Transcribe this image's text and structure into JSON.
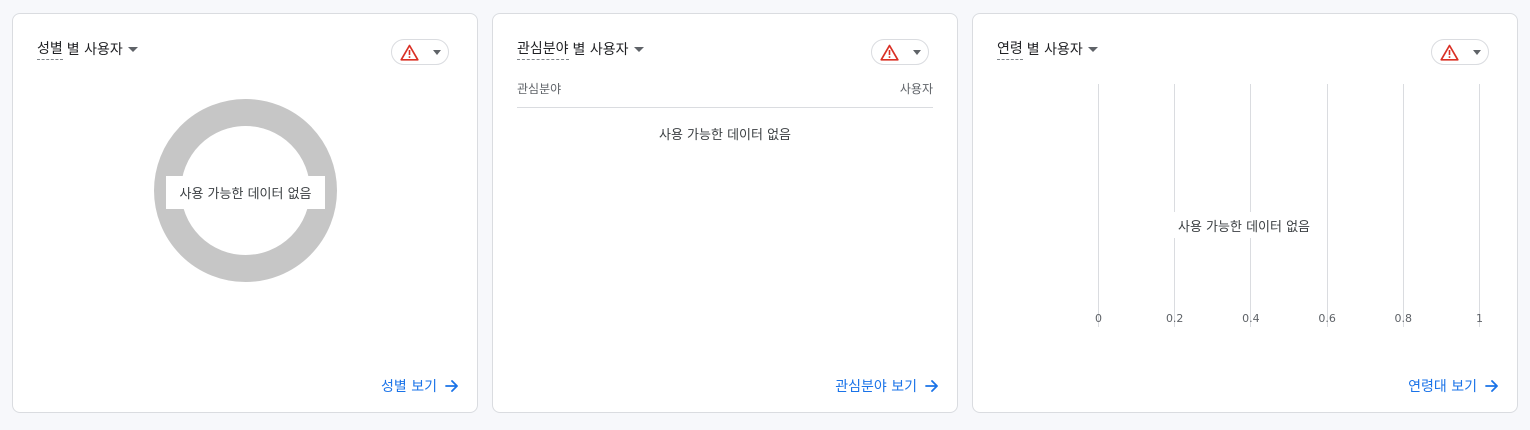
{
  "colors": {
    "accent": "#1a73e8",
    "warning": "#d93025",
    "donut_empty": "#c6c6c6",
    "text": "#3c4043"
  },
  "cards": {
    "gender": {
      "title_dimension": "성별",
      "title_rest": "별 사용자",
      "no_data": "사용 가능한 데이터 없음",
      "view_link": "성별 보기"
    },
    "interest": {
      "title_dimension": "관심분야",
      "title_rest": "별 사용자",
      "column_dimension": "관심분야",
      "column_users": "사용자",
      "no_data": "사용 가능한 데이터 없음",
      "view_link": "관심분야 보기"
    },
    "age": {
      "title_dimension": "연령",
      "title_rest": "별 사용자",
      "no_data": "사용 가능한 데이터 없음",
      "view_link": "연령대 보기"
    }
  },
  "icons": {
    "warning": "warning-triangle-icon",
    "caret": "caret-down-icon",
    "arrow": "arrow-right-icon"
  },
  "chart_data": [
    {
      "type": "pie",
      "title": "성별 별 사용자",
      "values": [],
      "categories": []
    },
    {
      "type": "table",
      "title": "관심분야 별 사용자",
      "columns": [
        "관심분야",
        "사용자"
      ],
      "rows": []
    },
    {
      "type": "bar",
      "title": "연령 별 사용자",
      "categories": [],
      "values": [],
      "xlim": [
        0,
        1
      ],
      "x_ticks": [
        "0",
        "0.2",
        "0.4",
        "0.6",
        "0.8",
        "1"
      ],
      "grid": true
    }
  ]
}
